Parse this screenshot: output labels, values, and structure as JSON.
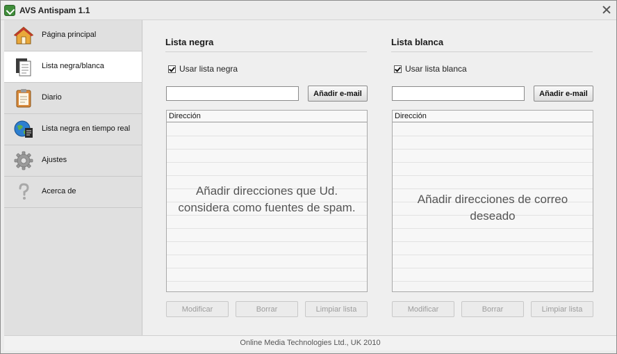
{
  "window": {
    "title": "AVS Antispam 1.1"
  },
  "sidebar": {
    "items": [
      {
        "label": "Página principal",
        "icon": "home-icon"
      },
      {
        "label": "Lista negra/blanca",
        "icon": "document-list-icon",
        "active": true
      },
      {
        "label": "Diario",
        "icon": "clipboard-icon"
      },
      {
        "label": "Lista negra en tiempo real",
        "icon": "globe-document-icon"
      },
      {
        "label": "Ajustes",
        "icon": "gear-icon"
      },
      {
        "label": "Acerca de",
        "icon": "question-mark-icon"
      }
    ]
  },
  "blacklist": {
    "title": "Lista negra",
    "checkbox_label": "Usar lista negra",
    "checked": true,
    "email_value": "",
    "add_button": "Añadir e-mail",
    "column_header": "Dirección",
    "hint": "Añadir direcciones que Ud. considera como fuentes de spam.",
    "modify_button": "Modificar",
    "delete_button": "Borrar",
    "clear_button": "Limpiar lista"
  },
  "whitelist": {
    "title": "Lista blanca",
    "checkbox_label": "Usar lista blanca",
    "checked": true,
    "email_value": "",
    "add_button": "Añadir e-mail",
    "column_header": "Dirección",
    "hint": "Añadir direcciones de correo deseado",
    "modify_button": "Modificar",
    "delete_button": "Borrar",
    "clear_button": "Limpiar lista"
  },
  "footer": {
    "text": "Online Media Technologies Ltd., UK 2010"
  },
  "colors": {
    "window_bg": "#ececec",
    "active_item_bg": "#ffffff",
    "disabled_text": "#9c9c9c"
  }
}
